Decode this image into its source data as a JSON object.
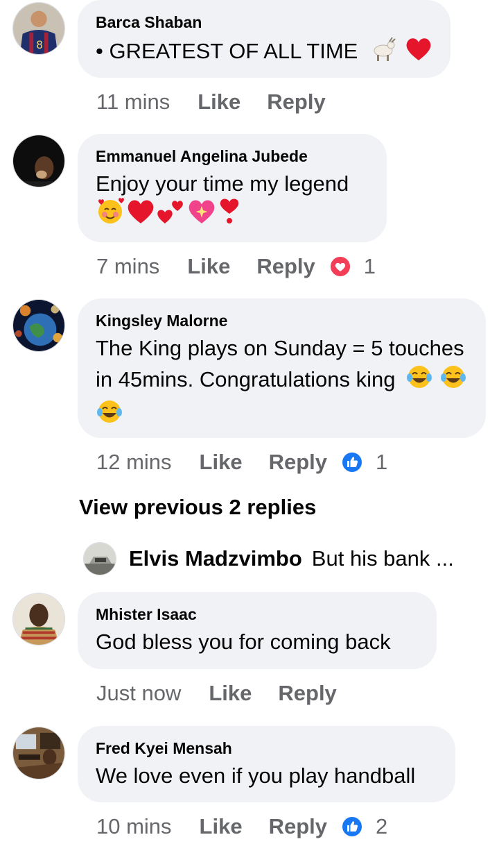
{
  "comments": [
    {
      "author": "Barca Shaban",
      "text": "• GREATEST OF ALL TIME",
      "time": "11 mins",
      "like_label": "Like",
      "reply_label": "Reply"
    },
    {
      "author": "Emmanuel Angelina Jubede",
      "text": "Enjoy your time my legend",
      "time": "7 mins",
      "like_label": "Like",
      "reply_label": "Reply",
      "reaction": "love",
      "reaction_count": "1"
    },
    {
      "author": "Kingsley Malorne",
      "text": "The King plays on Sunday = 5 touches in 45mins. Congratulations king",
      "time": "12 mins",
      "like_label": "Like",
      "reply_label": "Reply",
      "reaction": "like",
      "reaction_count": "1"
    },
    {
      "author": "Mhister Isaac",
      "text": "God bless you for coming back",
      "time": "Just now",
      "like_label": "Like",
      "reply_label": "Reply"
    },
    {
      "author": "Fred Kyei Mensah",
      "text": "We love even if you play handball",
      "time": "10 mins",
      "like_label": "Like",
      "reply_label": "Reply",
      "reaction": "like",
      "reaction_count": "2"
    }
  ],
  "view_previous": "View previous 2 replies",
  "reply_preview": {
    "author": "Elvis Madzvimbo",
    "text": "But his bank ..."
  },
  "colors": {
    "bubble": "#f0f2f5",
    "meta": "#65676b",
    "like_blue": "#1877f2",
    "love_red": "#f33e58"
  }
}
